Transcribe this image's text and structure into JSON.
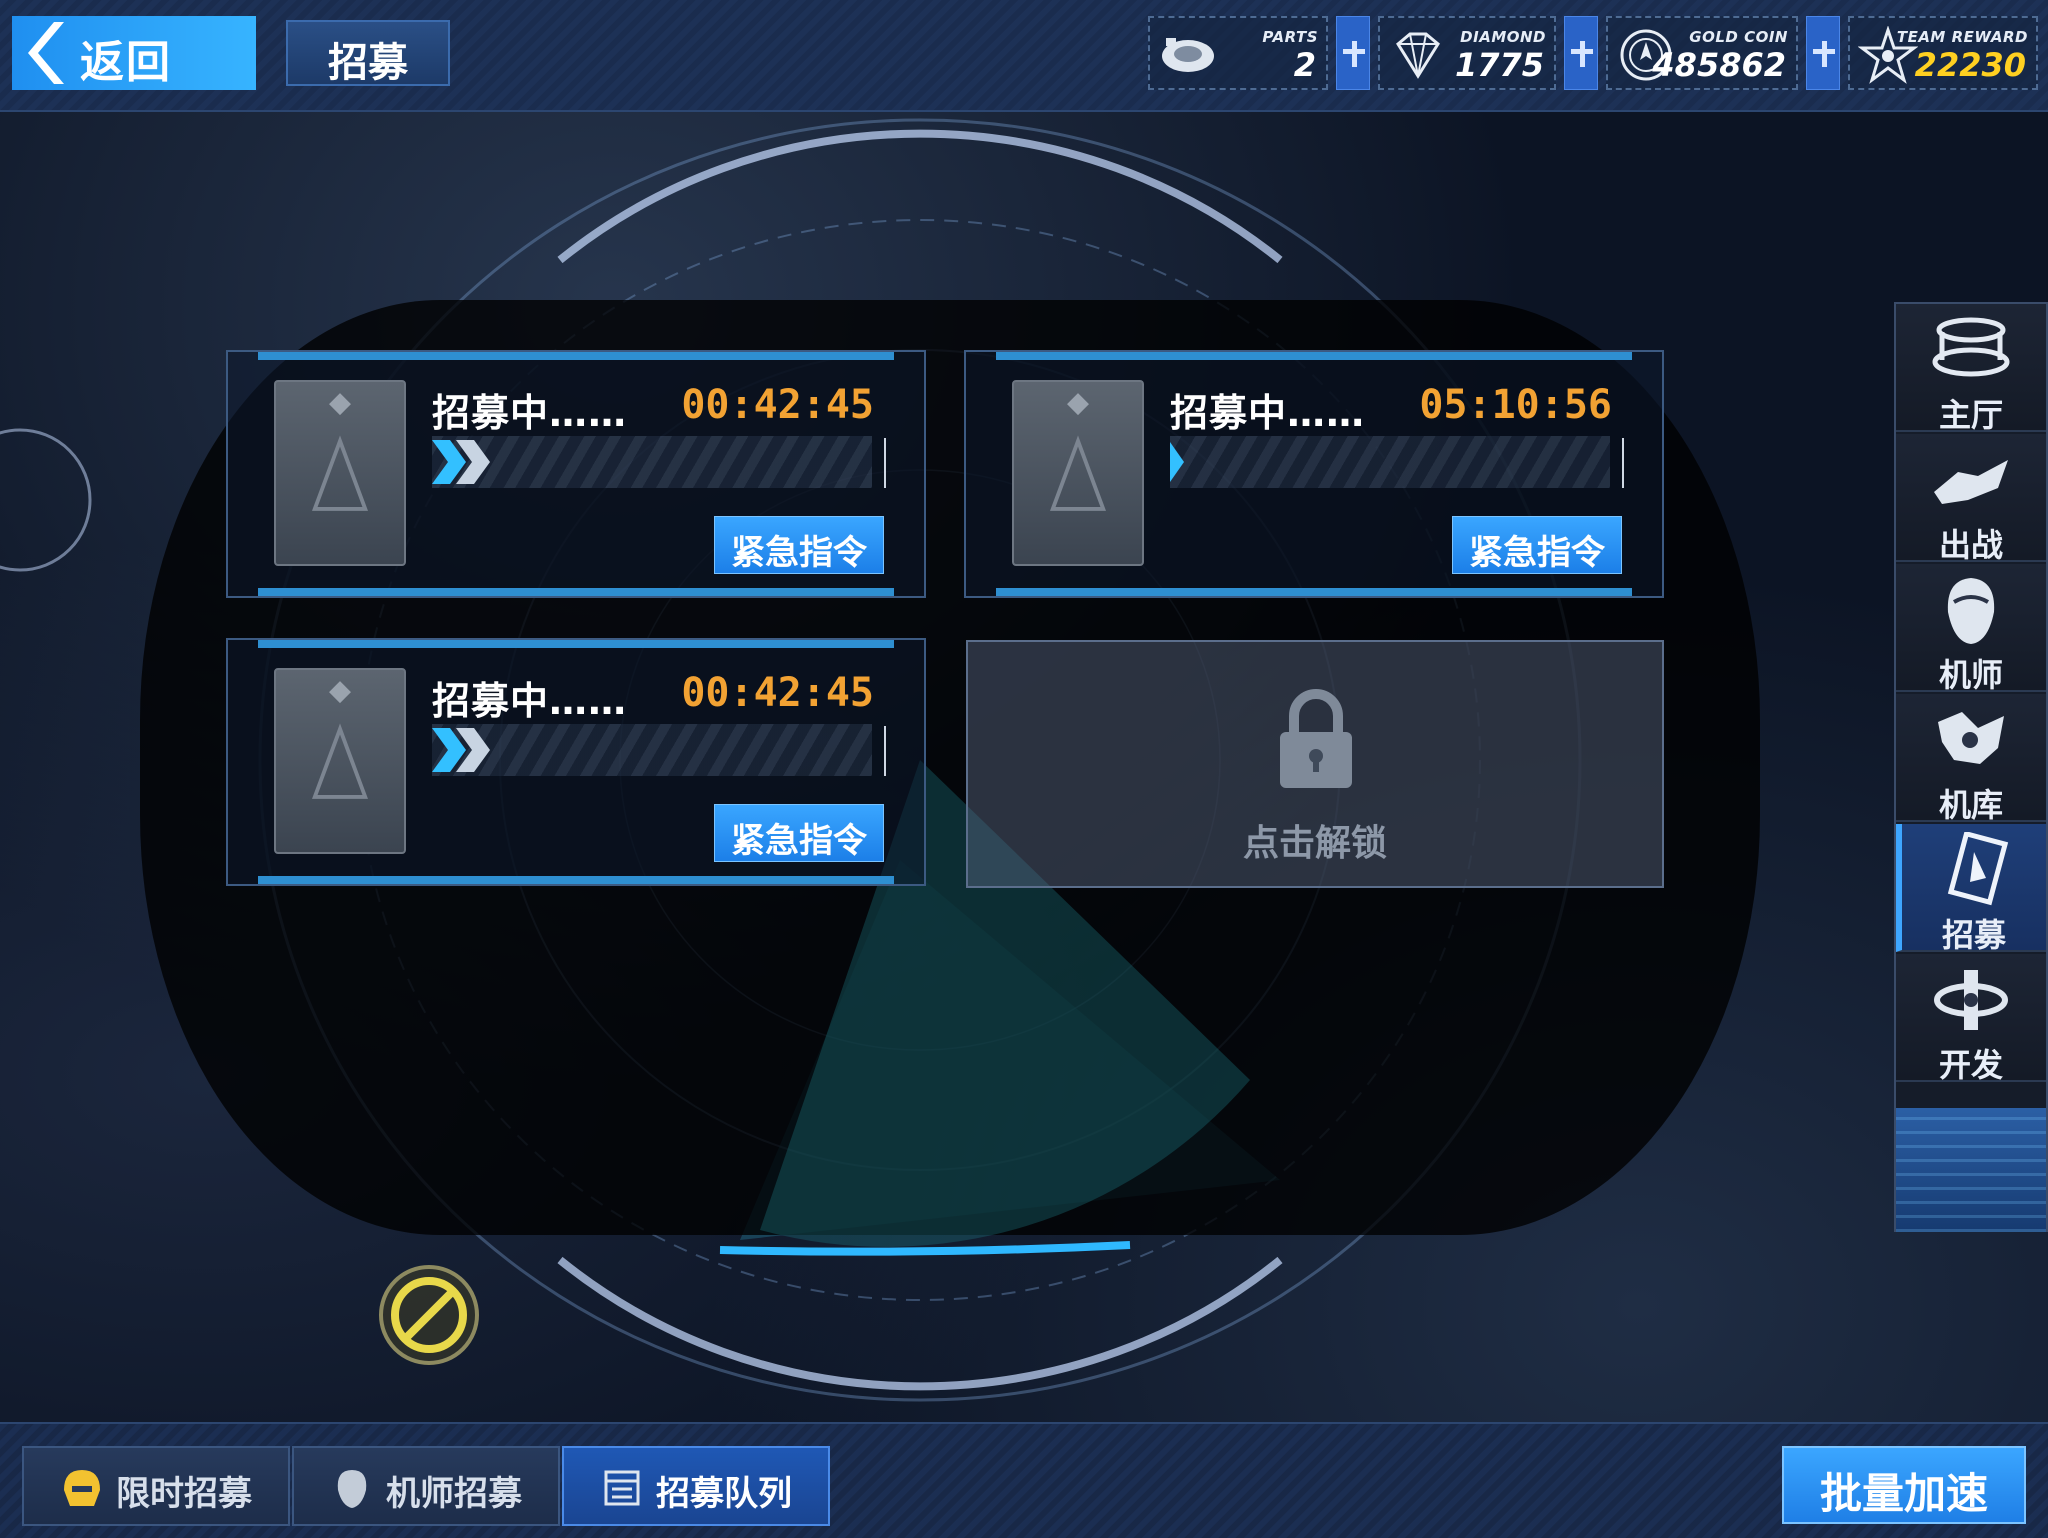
{
  "header": {
    "back_label": "返回",
    "title": "招募"
  },
  "resources": [
    {
      "key": "parts",
      "label": "PARTS",
      "value": "2",
      "icon": "parts-icon",
      "color": "#ffffff"
    },
    {
      "key": "diamond",
      "label": "DIAMOND",
      "value": "1775",
      "icon": "diamond-icon",
      "color": "#ffffff"
    },
    {
      "key": "gold",
      "label": "GOLD COIN",
      "value": "485862",
      "icon": "gold-coin-icon",
      "color": "#ffffff"
    },
    {
      "key": "team",
      "label": "TEAM REWARD",
      "value": "22230",
      "icon": "team-reward-icon",
      "color": "#ffd021"
    }
  ],
  "slots": [
    {
      "status": "招募中……",
      "timer": "00:42:45",
      "button": "紧急指令"
    },
    {
      "status": "招募中……",
      "timer": "05:10:56",
      "button": "紧急指令"
    },
    {
      "status": "招募中……",
      "timer": "00:42:45",
      "button": "紧急指令"
    }
  ],
  "locked_slot": {
    "label": "点击解锁",
    "icon": "lock-icon"
  },
  "sidenav": [
    {
      "label": "主厅",
      "icon": "hall-icon"
    },
    {
      "label": "出战",
      "icon": "battle-icon"
    },
    {
      "label": "机师",
      "icon": "pilot-icon"
    },
    {
      "label": "机库",
      "icon": "hangar-icon"
    },
    {
      "label": "招募",
      "icon": "recruit-icon",
      "active": true
    },
    {
      "label": "开发",
      "icon": "develop-icon"
    }
  ],
  "bottom_tabs": [
    {
      "label": "限时招募",
      "icon": "helmet-icon"
    },
    {
      "label": "机师招募",
      "icon": "pilot-head-icon"
    },
    {
      "label": "招募队列",
      "icon": "queue-list-icon",
      "active": true
    }
  ],
  "batch_button": "批量加速",
  "colors": {
    "accent": "#1f8ff0",
    "timer": "#f2a233",
    "team_reward": "#ffd021"
  }
}
